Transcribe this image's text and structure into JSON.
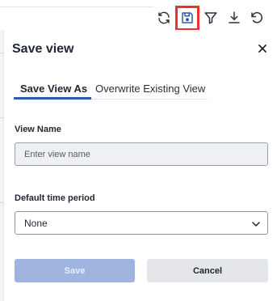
{
  "toolbar": {
    "icons": [
      "refresh-icon",
      "save-icon",
      "filter-icon",
      "download-icon",
      "undo-icon"
    ],
    "highlight_color": "#e8352b"
  },
  "dialog": {
    "title": "Save view",
    "tabs": [
      {
        "label": "Save View As",
        "active": true
      },
      {
        "label": "Overwrite Existing View",
        "active": false
      }
    ],
    "view_name": {
      "label": "View Name",
      "placeholder": "Enter view name",
      "value": ""
    },
    "time_period": {
      "label": "Default time period",
      "selected": "None"
    },
    "buttons": {
      "save_label": "Save",
      "cancel_label": "Cancel"
    }
  },
  "colors": {
    "accent": "#2a5fa8",
    "save_disabled": "#9fb5df",
    "cancel_bg": "#e4e6ea"
  }
}
